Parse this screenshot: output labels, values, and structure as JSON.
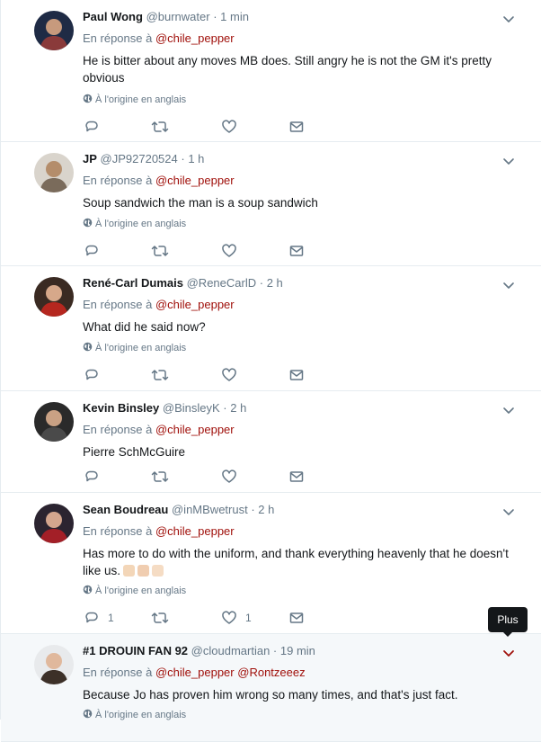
{
  "colors": {
    "accent": "#a0100b",
    "muted": "#657786",
    "text": "#14171a",
    "border": "#e6ecf0"
  },
  "tooltip": {
    "label": "Plus"
  },
  "tweets": [
    {
      "fullname": "Paul Wong",
      "handle": "@burnwater",
      "sep": "·",
      "time": "1 min",
      "reply_prefix": "En réponse à",
      "mentions": [
        "@chile_pepper"
      ],
      "text": "He is bitter about any moves MB does. Still angry he is not the GM it's pretty obvious",
      "translate": "À l'origine en anglais",
      "reply_count": "",
      "like_count": "",
      "avatar": "avatar-photo"
    },
    {
      "fullname": "JP",
      "handle": "@JP92720524",
      "sep": "·",
      "time": "1 h",
      "reply_prefix": "En réponse à",
      "mentions": [
        "@chile_pepper"
      ],
      "text": "Soup sandwich the man is a soup sandwich",
      "translate": "À l'origine en anglais",
      "reply_count": "",
      "like_count": "",
      "avatar": "avatar-photo"
    },
    {
      "fullname": "René-Carl Dumais",
      "handle": "@ReneCarlD",
      "sep": "·",
      "time": "2 h",
      "reply_prefix": "En réponse à",
      "mentions": [
        "@chile_pepper"
      ],
      "text": "What did he said now?",
      "translate": "À l'origine en anglais",
      "reply_count": "",
      "like_count": "",
      "avatar": "avatar-photo"
    },
    {
      "fullname": "Kevin Binsley",
      "handle": "@BinsleyK",
      "sep": "·",
      "time": "2 h",
      "reply_prefix": "En réponse à",
      "mentions": [
        "@chile_pepper"
      ],
      "text": "Pierre SchMcGuire",
      "translate": "",
      "reply_count": "",
      "like_count": "",
      "avatar": "avatar-photo"
    },
    {
      "fullname": "Sean Boudreau",
      "handle": "@inMBwetrust",
      "sep": "·",
      "time": "2 h",
      "reply_prefix": "En réponse à",
      "mentions": [
        "@chile_pepper"
      ],
      "text": "Has more to do with the uniform, and thank everything heavenly that he doesn't like us.",
      "emojis": [
        "raised-hands",
        "clapping-hands",
        "ok-hand"
      ],
      "translate": "À l'origine en anglais",
      "reply_count": "1",
      "like_count": "1",
      "avatar": "avatar-photo"
    },
    {
      "fullname": "#1 DROUIN FAN 92",
      "handle": "@cloudmartian",
      "sep": "·",
      "time": "19 min",
      "reply_prefix": "En réponse à",
      "mentions": [
        "@chile_pepper",
        "@Rontzeeez"
      ],
      "text": "Because Jo has proven him wrong so many times, and that's just fact.",
      "translate": "À l'origine en anglais",
      "reply_count": "",
      "like_count": "",
      "avatar": "avatar-photo"
    }
  ],
  "icons": {
    "reply": "reply-icon",
    "retweet": "retweet-icon",
    "like": "heart-icon",
    "dm": "envelope-icon",
    "more": "chevron-down-icon",
    "globe": "globe-icon"
  }
}
